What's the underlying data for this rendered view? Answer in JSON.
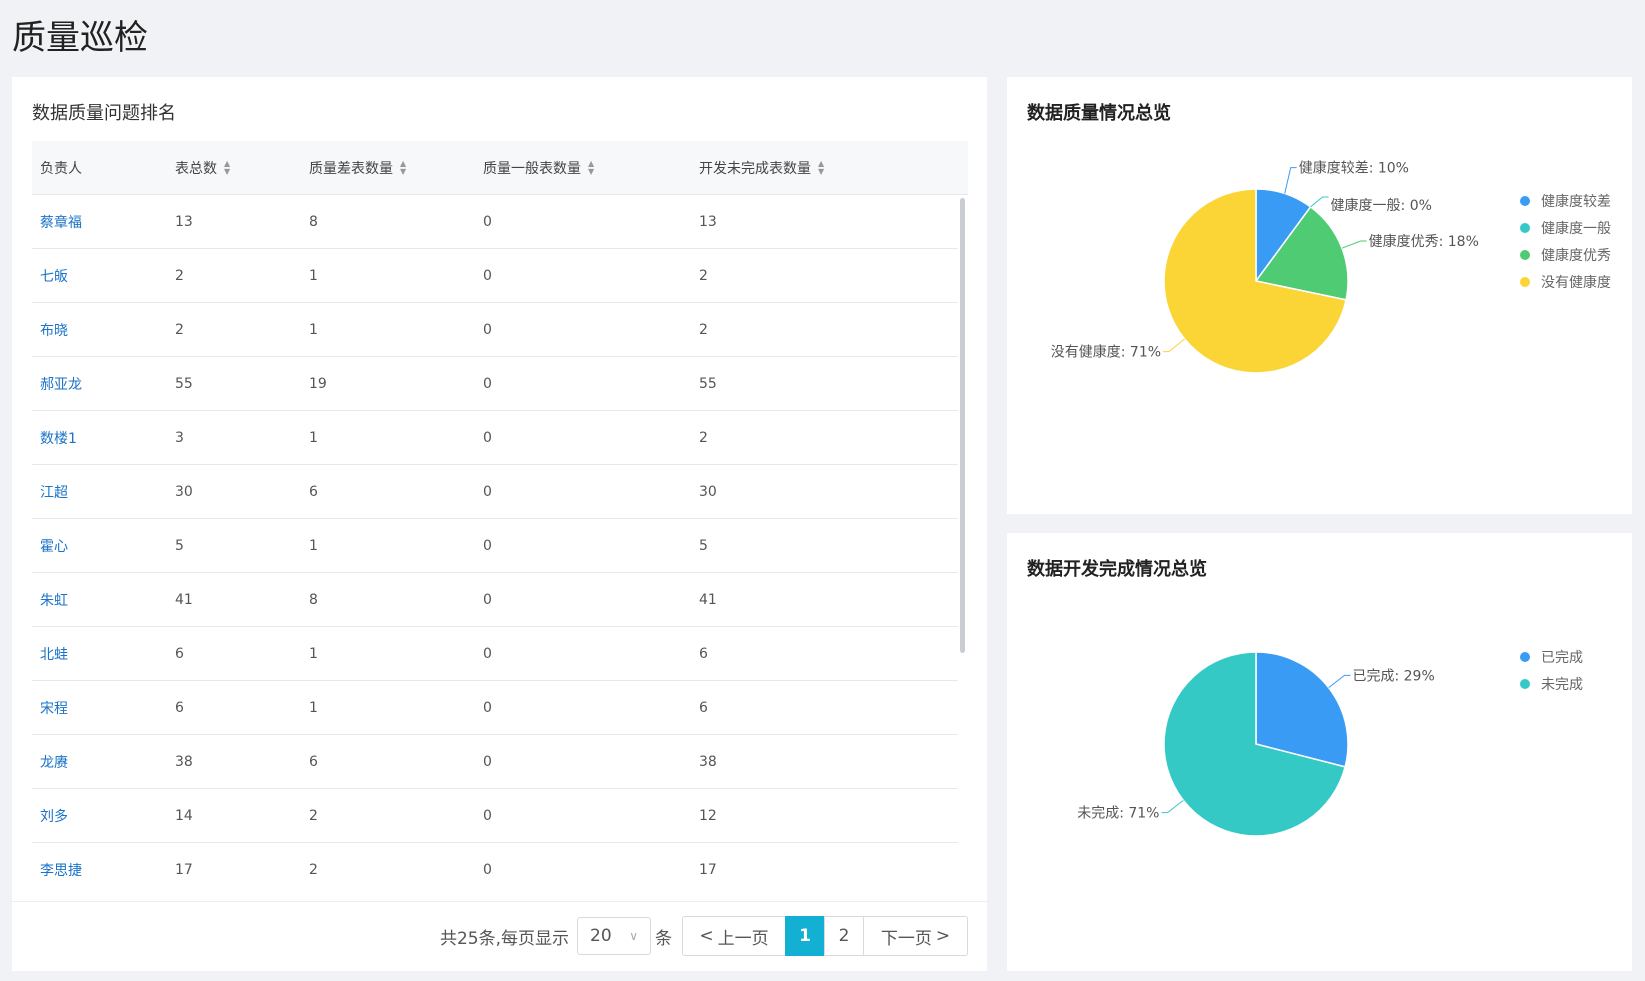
{
  "page": {
    "title": "质量巡检"
  },
  "ranking": {
    "title": "数据质量问题排名",
    "columns": [
      "负责人",
      "表总数",
      "质量差表数量",
      "质量一般表数量",
      "开发未完成表数量"
    ],
    "rows": [
      [
        "蔡章福",
        "13",
        "8",
        "0",
        "13"
      ],
      [
        "七皈",
        "2",
        "1",
        "0",
        "2"
      ],
      [
        "布晓",
        "2",
        "1",
        "0",
        "2"
      ],
      [
        "郝亚龙",
        "55",
        "19",
        "0",
        "55"
      ],
      [
        "数楼1",
        "3",
        "1",
        "0",
        "2"
      ],
      [
        "江超",
        "30",
        "6",
        "0",
        "30"
      ],
      [
        "霍心",
        "5",
        "1",
        "0",
        "5"
      ],
      [
        "朱虹",
        "41",
        "8",
        "0",
        "41"
      ],
      [
        "北蛙",
        "6",
        "1",
        "0",
        "6"
      ],
      [
        "宋程",
        "6",
        "1",
        "0",
        "6"
      ],
      [
        "龙赓",
        "38",
        "6",
        "0",
        "38"
      ],
      [
        "刘多",
        "14",
        "2",
        "0",
        "12"
      ],
      [
        "李思捷",
        "17",
        "2",
        "0",
        "17"
      ]
    ]
  },
  "pagination": {
    "total_text": "共25条,每页显示",
    "page_size": "20",
    "unit": "条",
    "prev_label": "上一页",
    "next_label": "下一页",
    "pages": [
      "1",
      "2"
    ],
    "current_page": "1",
    "active_color": "#14b0d4"
  },
  "icons": {
    "sort": "sort-caret-icon",
    "chevron_down": "chevron-down-icon",
    "chevron_left": "chevron-left-icon",
    "chevron_right": "chevron-right-icon"
  },
  "charts": [
    {
      "title": "数据质量情况总览",
      "chart_data": {
        "type": "pie",
        "labels": [
          "健康度较差",
          "健康度一般",
          "健康度优秀",
          "没有健康度"
        ],
        "values": [
          10,
          0,
          18,
          71
        ],
        "unit": "%",
        "slice_labels": [
          "健康度较差: 10%",
          "健康度一般: 0%",
          "健康度优秀: 18%",
          "没有健康度: 71%"
        ],
        "colors": [
          "#3a9bf5",
          "#35c9c6",
          "#4ecb73",
          "#fbd436"
        ],
        "legend": "right"
      }
    },
    {
      "title": "数据开发完成情况总览",
      "chart_data": {
        "type": "pie",
        "labels": [
          "已完成",
          "未完成"
        ],
        "values": [
          29,
          71
        ],
        "unit": "%",
        "slice_labels": [
          "已完成: 29%",
          "未完成: 71%"
        ],
        "colors": [
          "#3a9bf5",
          "#35c9c6"
        ],
        "legend": "right"
      }
    }
  ]
}
